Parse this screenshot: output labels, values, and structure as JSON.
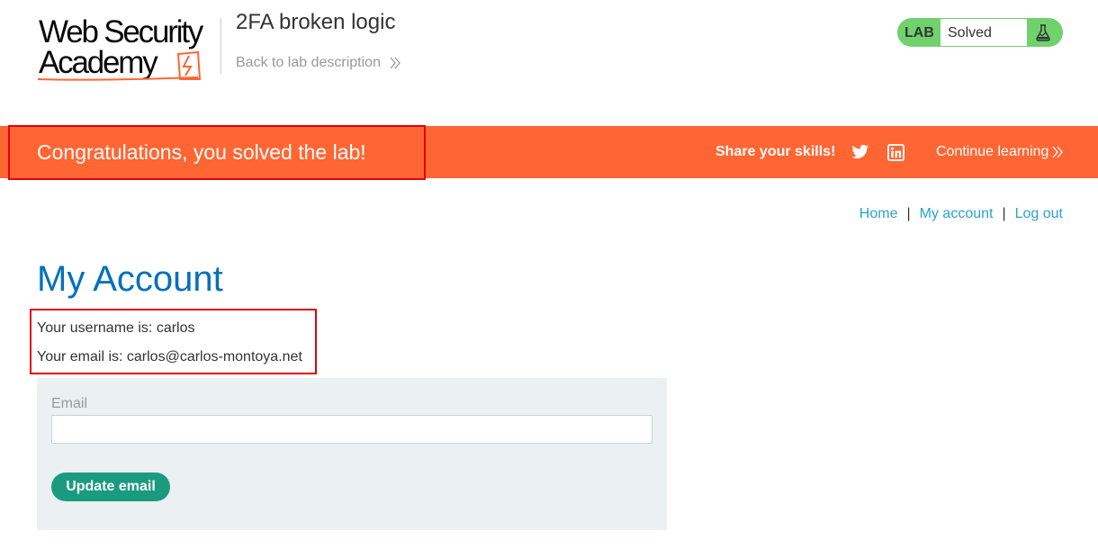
{
  "header": {
    "logo_line1": "Web Security",
    "logo_line2": "Academy",
    "lab_title": "2FA broken logic",
    "back_link": "Back to lab description",
    "lab_label": "LAB",
    "lab_status": "Solved"
  },
  "banner": {
    "message": "Congratulations, you solved the lab!",
    "share_label": "Share your skills!",
    "continue_label": "Continue learning"
  },
  "nav": {
    "home": "Home",
    "separator": "|",
    "my_account": "My account",
    "log_out": "Log out"
  },
  "account": {
    "title": "My Account",
    "username_line": "Your username is: carlos",
    "email_line": "Your email is: carlos@carlos-montoya.net"
  },
  "form": {
    "email_label": "Email",
    "email_value": "",
    "button_label": "Update email"
  },
  "colors": {
    "banner": "#ff6633",
    "solved_badge": "#70d16d",
    "title_blue": "#0071bc",
    "link_blue": "#29a3cc",
    "button_green": "#1a9b7f",
    "highlight_red": "#e3000f"
  },
  "icons": [
    "academy-logo-icon",
    "double-chevron-right-icon",
    "flask-icon",
    "twitter-icon",
    "linkedin-icon"
  ]
}
